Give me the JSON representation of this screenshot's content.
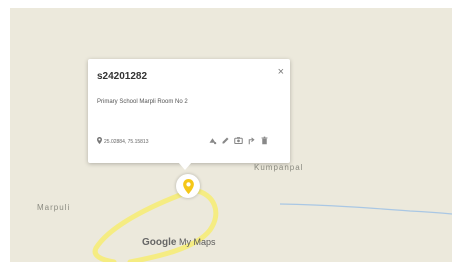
{
  "info_window": {
    "title": "s24201282",
    "description": "Primary School Marpli Room No 2",
    "coordinates": "25.02884, 75.15813",
    "close_glyph": "×",
    "tools": [
      "style-icon",
      "edit-icon",
      "camera-icon",
      "directions-icon",
      "delete-icon"
    ]
  },
  "map": {
    "labels": {
      "marpuli": "Marpuli",
      "kumpanpal": "Kumpanpal"
    },
    "brand": {
      "google": "Google",
      "product": "My Maps"
    },
    "colors": {
      "land": "#ece9dc",
      "route": "#f5ec82",
      "marker": "#f5c718",
      "river": "#a9c7e4"
    }
  }
}
